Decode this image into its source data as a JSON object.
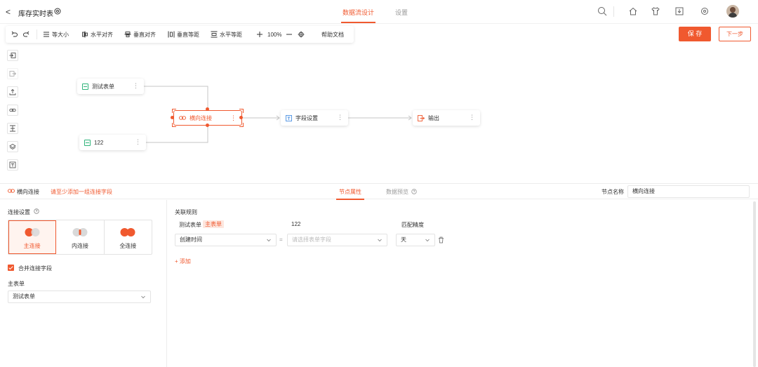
{
  "header": {
    "back_glyph": "<",
    "title": "库存实时表",
    "tabs": [
      {
        "label": "数据流设计",
        "active": true
      },
      {
        "label": "设置",
        "active": false
      }
    ],
    "icons": [
      "search-icon",
      "home-icon",
      "shirt-icon",
      "download-icon",
      "settings-icon",
      "avatar"
    ]
  },
  "toolbar": {
    "items": [
      {
        "label": "等大小",
        "icon": "equal-size-icon"
      },
      {
        "label": "水平对齐",
        "icon": "align-horizontal-icon"
      },
      {
        "label": "垂直对齐",
        "icon": "align-vertical-icon"
      },
      {
        "label": "垂直等距",
        "icon": "distribute-vertical-icon"
      },
      {
        "label": "水平等距",
        "icon": "distribute-horizontal-icon"
      }
    ],
    "zoom": "100%",
    "help_label": "帮助文档",
    "save_label": "保 存",
    "next_label": "下一步"
  },
  "side_tools": [
    "input-icon",
    "output-icon",
    "upload-icon",
    "link-icon",
    "merge-icon",
    "layers-icon",
    "text-icon"
  ],
  "canvas": {
    "nodes": {
      "form": "测试表单",
      "n122": "122",
      "join": "横向连接",
      "field": "字段设置",
      "output": "输出"
    }
  },
  "panel": {
    "node_name": "横向连接",
    "warning": "请至少添加一组连接字段",
    "tabs": [
      {
        "label": "节点属性",
        "active": true
      },
      {
        "label": "数据预览",
        "active": false
      }
    ],
    "node_name_label": "节点名称",
    "node_name_value": "横向连接",
    "join_settings_label": "连接设置",
    "join_options": [
      {
        "label": "主连接",
        "active": true
      },
      {
        "label": "内连接",
        "active": false
      },
      {
        "label": "全连接",
        "active": false
      }
    ],
    "merge_label": "合并连接字段",
    "main_table_label": "主表单",
    "main_table_value": "测试表单",
    "rules_label": "关联规则",
    "col_left": "测试表单",
    "col_left_tag": "主表单",
    "col_mid": "122",
    "col_right": "匹配精度",
    "rule_left_value": "创建时间",
    "rule_eq": "=",
    "rule_mid_placeholder": "请选择表单字段",
    "rule_right_value": "天",
    "add_label": "+ 添加"
  },
  "colors": {
    "accent": "#f0592f",
    "green": "#2fb37a"
  }
}
